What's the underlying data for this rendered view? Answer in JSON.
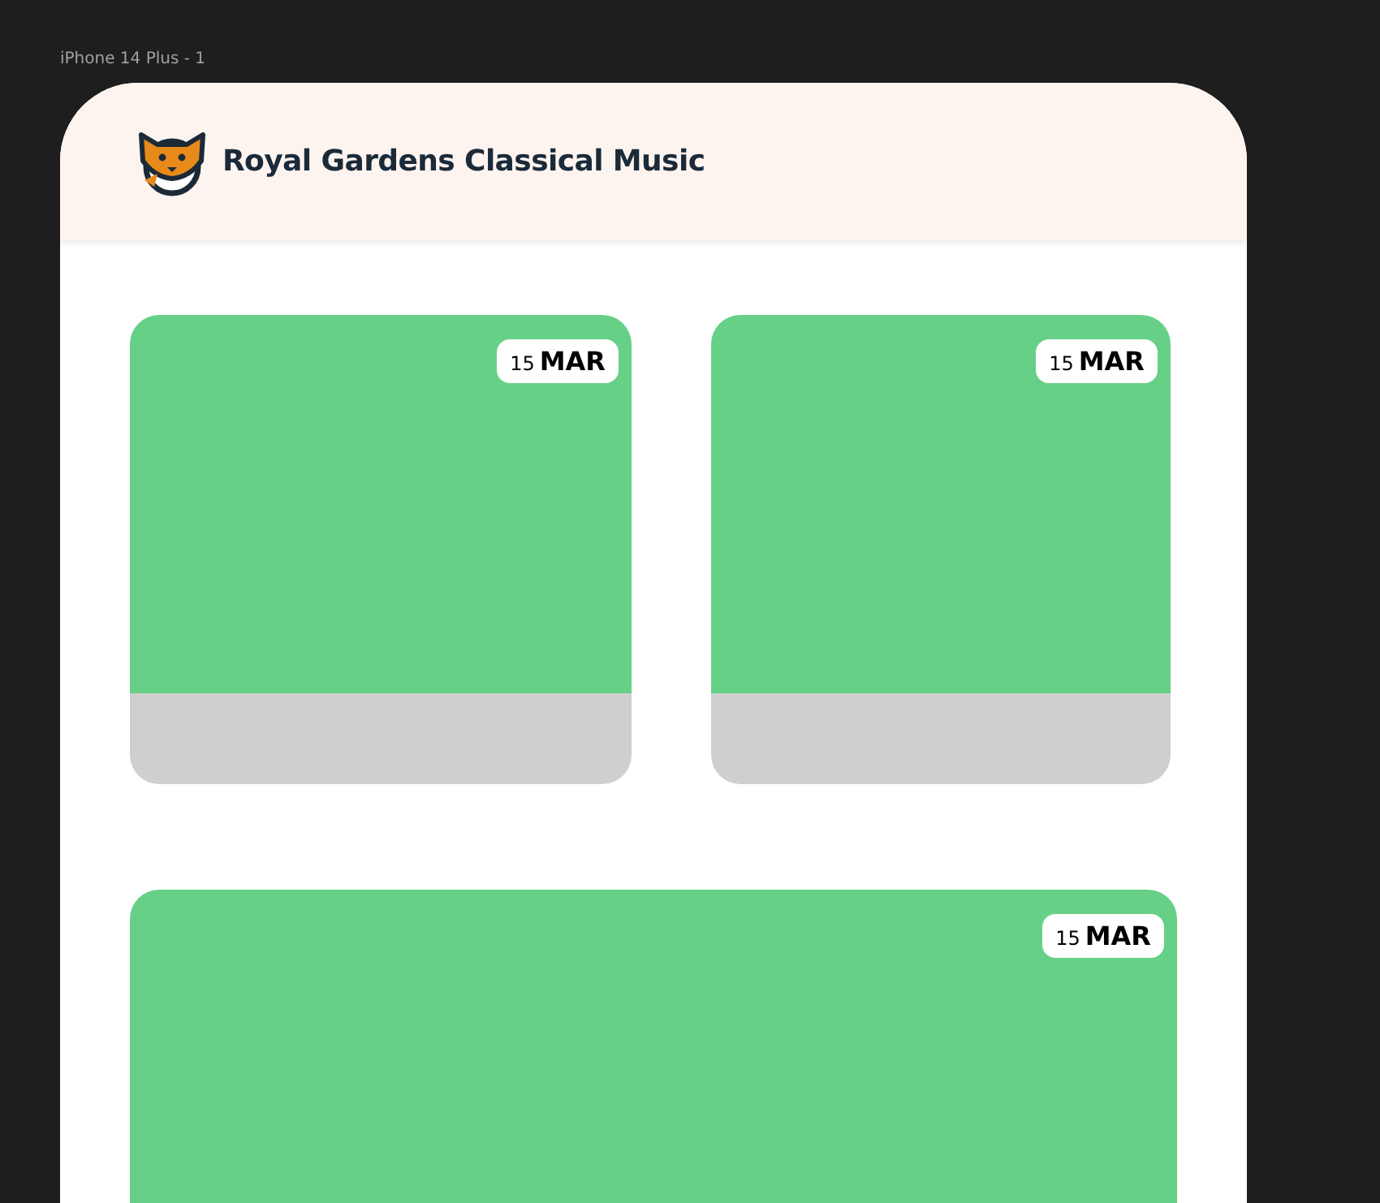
{
  "canvas": {
    "frame_label": "iPhone 14 Plus - 1"
  },
  "header": {
    "title": "Royal Gardens Classical Music"
  },
  "cards": [
    {
      "day": "15",
      "month": "MAR",
      "kind": "footer"
    },
    {
      "day": "15",
      "month": "MAR",
      "kind": "footer"
    },
    {
      "day": "15",
      "month": "MAR",
      "kind": "wide"
    }
  ]
}
